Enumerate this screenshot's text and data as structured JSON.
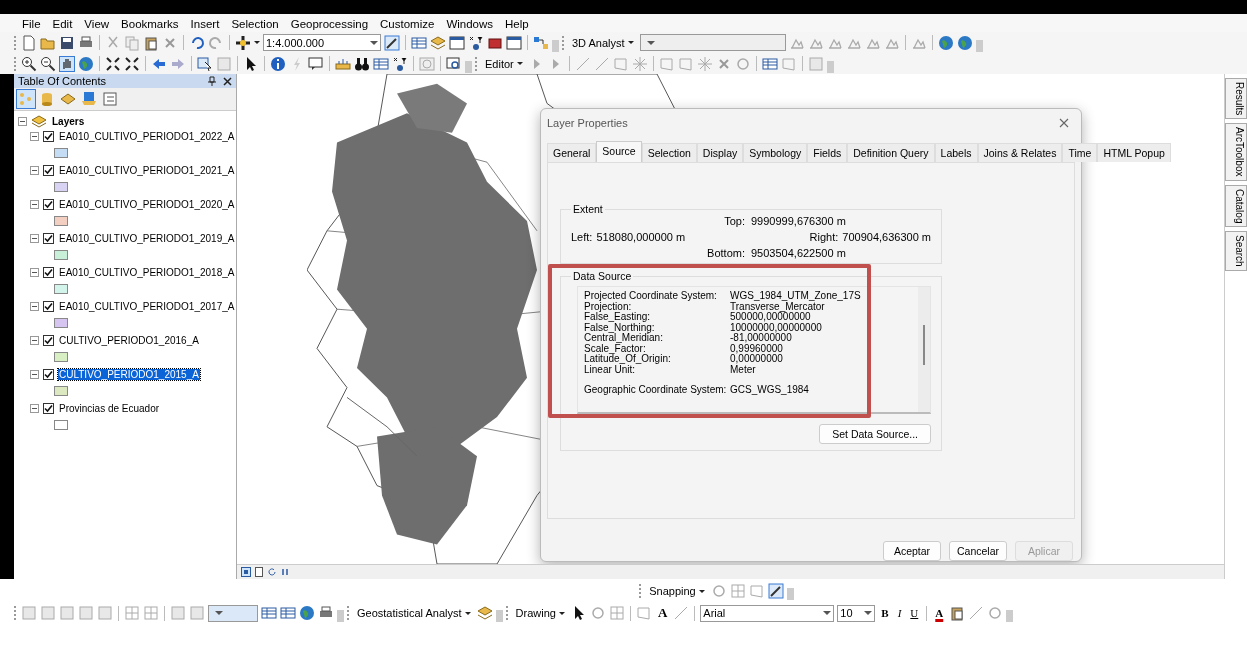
{
  "menu_bar": [
    "File",
    "Edit",
    "View",
    "Bookmarks",
    "Insert",
    "Selection",
    "Geoprocessing",
    "Customize",
    "Windows",
    "Help"
  ],
  "standard_toolbar": {
    "scale": "1:4.000.000"
  },
  "analyst_3d_toolbar": {
    "label": "3D Analyst"
  },
  "editor_toolbar": {
    "label": "Editor"
  },
  "table_of_contents": {
    "title": "Table Of Contents",
    "root": {
      "label": "Layers",
      "expanded": true,
      "children": [
        {
          "label": "EA010_CULTIVO_PERIODO1_2022_A",
          "checked": true,
          "expanded": true,
          "selected": false,
          "color": "#c5dcf5"
        },
        {
          "label": "EA010_CULTIVO_PERIODO1_2021_A",
          "checked": true,
          "expanded": true,
          "selected": false,
          "color": "#d9d3f3"
        },
        {
          "label": "EA010_CULTIVO_PERIODO1_2020_A",
          "checked": true,
          "expanded": true,
          "selected": false,
          "color": "#f2cfc0"
        },
        {
          "label": "EA010_CULTIVO_PERIODO1_2019_A",
          "checked": true,
          "expanded": true,
          "selected": false,
          "color": "#c8f0d8"
        },
        {
          "label": "EA010_CULTIVO_PERIODO1_2018_A",
          "checked": true,
          "expanded": true,
          "selected": false,
          "color": "#d2f4ea"
        },
        {
          "label": "EA010_CULTIVO_PERIODO1_2017_A",
          "checked": true,
          "expanded": true,
          "selected": false,
          "color": "#d6c5f0"
        },
        {
          "label": "CULTIVO_PERIODO1_2016_A",
          "checked": true,
          "expanded": true,
          "selected": false,
          "color": "#d8efc4"
        },
        {
          "label": "CULTIVO_PERIODO1_2015_A",
          "checked": true,
          "expanded": true,
          "selected": true,
          "color": "#dbe8c0"
        },
        {
          "label": "Provincias de Ecuador",
          "checked": true,
          "expanded": true,
          "selected": false,
          "color": "#ffffff"
        }
      ]
    }
  },
  "side_tabs": [
    "Results",
    "ArcToolbox",
    "Catalog",
    "Search"
  ],
  "layer_properties": {
    "title": "Layer Properties",
    "tabs": [
      {
        "label": "General",
        "selected": false
      },
      {
        "label": "Source",
        "selected": true
      },
      {
        "label": "Selection",
        "selected": false
      },
      {
        "label": "Display",
        "selected": false
      },
      {
        "label": "Symbology",
        "selected": false
      },
      {
        "label": "Fields",
        "selected": false
      },
      {
        "label": "Definition Query",
        "selected": false
      },
      {
        "label": "Labels",
        "selected": false
      },
      {
        "label": "Joins & Relates",
        "selected": false
      },
      {
        "label": "Time",
        "selected": false
      },
      {
        "label": "HTML Popup",
        "selected": false
      }
    ],
    "extent": {
      "title": "Extent",
      "top_label": "Top:",
      "top": "9990999,676300 m",
      "left_label": "Left:",
      "left": "518080,000000 m",
      "right_label": "Right:",
      "right": "700904,636300 m",
      "bottom_label": "Bottom:",
      "bottom": "9503504,622500 m"
    },
    "data_source": {
      "title": "Data Source",
      "sections": [
        [
          {
            "label": "Projected Coordinate System:",
            "value": "WGS_1984_UTM_Zone_17S"
          },
          {
            "label": "Projection:",
            "value": "Transverse_Mercator"
          },
          {
            "label": "False_Easting:",
            "value": "500000,00000000"
          },
          {
            "label": "False_Northing:",
            "value": "10000000,00000000"
          },
          {
            "label": "Central_Meridian:",
            "value": "-81,00000000"
          },
          {
            "label": "Scale_Factor:",
            "value": "0,99960000"
          },
          {
            "label": "Latitude_Of_Origin:",
            "value": "0,00000000"
          },
          {
            "label": "Linear Unit:",
            "value": "Meter"
          }
        ],
        [
          {
            "label": "Geographic Coordinate System:",
            "value": "GCS_WGS_1984"
          }
        ]
      ]
    },
    "set_data_source_button": "Set Data Source...",
    "buttons": [
      {
        "label": "Aceptar",
        "disabled": false
      },
      {
        "label": "Cancelar",
        "disabled": false
      },
      {
        "label": "Aplicar",
        "disabled": true
      }
    ]
  },
  "snapping_toolbar": {
    "label": "Snapping"
  },
  "geostatistical_toolbar": {
    "label": "Geostatistical Analyst"
  },
  "drawing_toolbar": {
    "label": "Drawing",
    "text_tool": "A",
    "font": "Arial",
    "font_size": "10",
    "bold": "B",
    "italic": "I",
    "underline": "U",
    "font_color": "A"
  }
}
